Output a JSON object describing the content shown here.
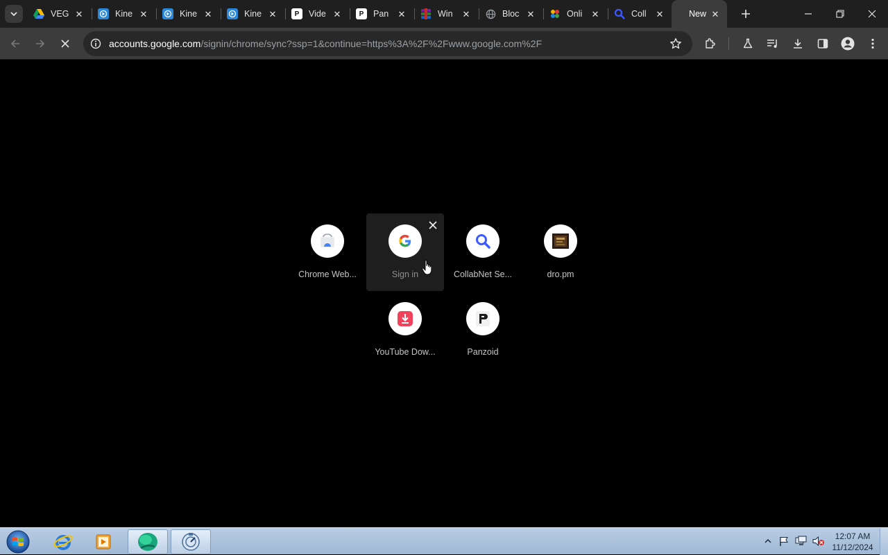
{
  "tabs": [
    {
      "title": "VEG",
      "icon": "google-drive-icon",
      "color": "#1a73e8"
    },
    {
      "title": "Kine",
      "icon": "kinemaster-icon",
      "color": "#1e88e5"
    },
    {
      "title": "Kine",
      "icon": "kinemaster-icon",
      "color": "#1e88e5"
    },
    {
      "title": "Kine",
      "icon": "kinemaster-icon",
      "color": "#1e88e5"
    },
    {
      "title": "Vide",
      "icon": "panzoid-icon",
      "color": "#ffffff"
    },
    {
      "title": "Pan",
      "icon": "panzoid-icon",
      "color": "#ffffff"
    },
    {
      "title": "Win",
      "icon": "winrar-icon",
      "color": "#8e3fb0"
    },
    {
      "title": "Bloc",
      "icon": "globe-icon",
      "color": "#9aa0a6"
    },
    {
      "title": "Onli",
      "icon": "dots-icon",
      "color": "#e53935"
    },
    {
      "title": "Coll",
      "icon": "search-icon",
      "color": "#3d5afe"
    },
    {
      "title": "New",
      "icon": "new-tab-icon",
      "color": "#3c3c3c",
      "active": true
    }
  ],
  "omnibox": {
    "host": "accounts.google.com",
    "path": "/signin/chrome/sync?ssp=1&continue=https%3A%2F%2Fwww.google.com%2F"
  },
  "shortcuts": [
    {
      "label": "Chrome Web...",
      "icon": "chrome-web-store-icon"
    },
    {
      "label": "Sign in",
      "icon": "google-g-icon",
      "hovered": true
    },
    {
      "label": "CollabNet Se...",
      "icon": "search-icon"
    },
    {
      "label": "dro.pm",
      "icon": "dro-pm-icon"
    },
    {
      "label": "YouTube Dow...",
      "icon": "download-icon"
    },
    {
      "label": "Panzoid",
      "icon": "panzoid-icon"
    }
  ],
  "taskbar": {
    "time": "12:07 AM",
    "date": "11/12/2024",
    "apps": [
      "internet-explorer-icon",
      "media-player-icon",
      "browser-icon",
      "app-icon"
    ]
  },
  "colors": {
    "tab_strip": "#1f1f1f",
    "toolbar": "#3c3c3c",
    "omnibox": "#282828",
    "page_bg": "#000000",
    "taskbar": "#b9cde3"
  }
}
